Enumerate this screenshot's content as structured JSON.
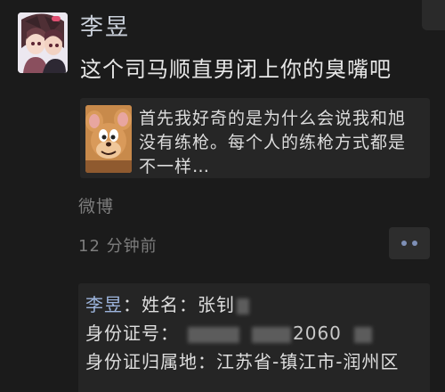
{
  "post": {
    "username": "李昱",
    "text": "这个司马顺直男闭上你的臭嘴吧",
    "shared_text": "首先我好奇的是为什么会说我和旭没有练枪。每个人的练枪方式都是不一样…",
    "source": "微博",
    "time": "12 分钟前"
  },
  "comment": {
    "author": "李昱",
    "line1_prefix": "：姓名：张钊",
    "line2_prefix": "身份证号：",
    "line2_visible": "2060",
    "line3_prefix": "身份证归属地：",
    "line3_location": "江苏省-镇江市-润州区"
  },
  "icons": {
    "more": "more-dots-icon"
  }
}
